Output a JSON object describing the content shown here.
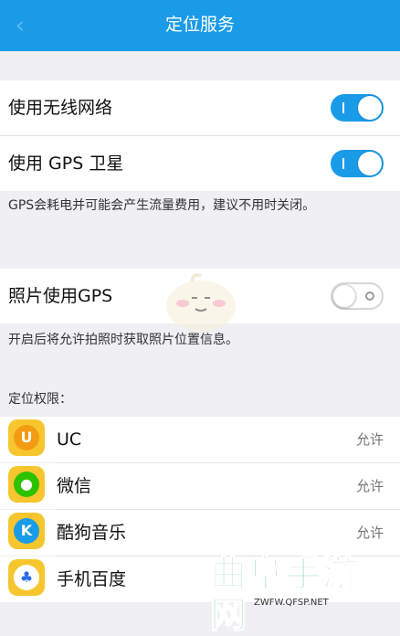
{
  "header": {
    "title": "定位服务",
    "back_icon": "chevron-left-icon"
  },
  "settings": {
    "wifi": {
      "label": "使用无线网络",
      "enabled": true
    },
    "gps": {
      "label": "使用 GPS 卫星",
      "enabled": true
    },
    "gps_note": "GPS会耗电并可能会产生流量费用，建议不用时关闭。",
    "photo_gps": {
      "label": "照片使用GPS",
      "enabled": false
    },
    "photo_note": "开启后将允许拍照时获取照片位置信息。"
  },
  "permissions": {
    "section_title": "定位权限：",
    "apps": [
      {
        "name": "UC",
        "permission": "允许",
        "icon": "uc-browser-icon",
        "color": "#f7c62f"
      },
      {
        "name": "微信",
        "permission": "允许",
        "icon": "wechat-icon",
        "color": "#f7c62f"
      },
      {
        "name": "酷狗音乐",
        "permission": "允许",
        "icon": "kugou-icon",
        "color": "#f7c62f"
      },
      {
        "name": "手机百度",
        "permission": "",
        "icon": "baidu-icon",
        "color": "#f7c62f"
      }
    ]
  },
  "watermark": {
    "text": "曲阜手游网",
    "url": "ZWFW.QFSP.NET"
  },
  "colors": {
    "accent": "#1a9be8",
    "app_icon_bg": "#f7c62f"
  }
}
